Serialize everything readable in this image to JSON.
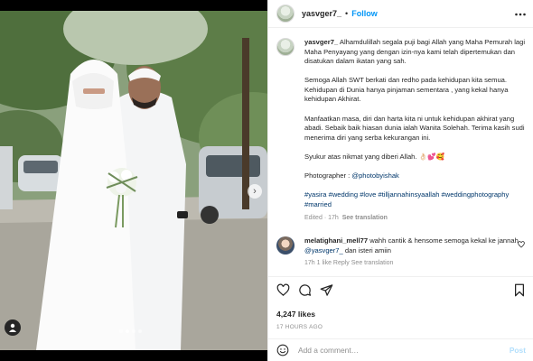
{
  "post": {
    "username": "yasvger7_",
    "follow_label": "Follow",
    "header_separator": "•",
    "more_icon": "more-horizontal-icon"
  },
  "caption": {
    "username": "yasvger7_",
    "p1": "Alhamdulillah segala puji bagi Allah yang Maha Pemurah lagi Maha Penyayang yang dengan izin-nya kami telah dipertemukan dan disatukan dalam ikatan yang sah.",
    "p2": "Semoga Allah SWT berkati dan redho pada kehidupan kita semua. Kehidupan di Dunia hanya pinjaman sementara , yang kekal hanya kehidupan Akhirat.",
    "p3": "Manfaatkan masa, diri dan harta kita ni untuk kehidupan akhirat yang abadi. Sebaik baik hiasan dunia ialah Wanita Solehah. Terima kasih sudi menerima diri yang serba kekurangan ini.",
    "p4": "Syukur atas nikmat yang diberi Allah. 👌🏻💕🥰",
    "photographer_label": "Photographer :",
    "photographer_handle": "@photobyishak",
    "hashtags": "#yasira #wedding #love #tilljannahinsyaallah #weddingphotography #married",
    "edited": "Edited",
    "meta_sep": "·",
    "time": "17h",
    "see_translation": "See translation"
  },
  "comment": {
    "username": "melatighani_mell77",
    "text_before": "wahh cantik & hensome semoga kekal ke jannah",
    "mention": "@yasvger7_",
    "text_after": "dan isteri amiin",
    "meta": "17h   1 like   Reply   See translation",
    "like_icon": "heart-outline-icon"
  },
  "actions": {
    "likes": "4,247 likes",
    "time_ago": "17 HOURS AGO"
  },
  "add_comment": {
    "placeholder": "Add a comment…",
    "post_label": "Post"
  },
  "carousel": {
    "slides": 4,
    "active": 2
  },
  "colors": {
    "accent": "#0095f6",
    "link": "#00376b",
    "muted": "#8e8e8e",
    "post_disabled": "#b2dffc"
  }
}
